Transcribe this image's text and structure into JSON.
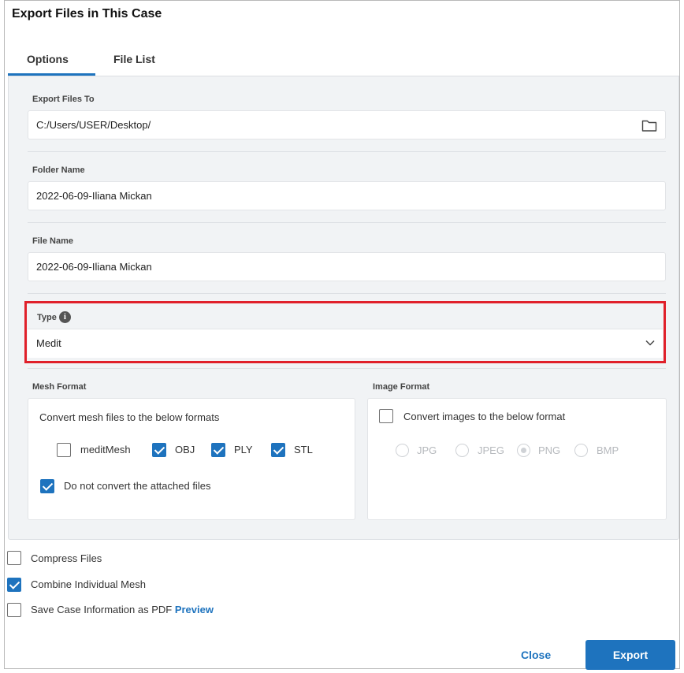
{
  "dialog": {
    "title": "Export Files in This Case"
  },
  "tabs": [
    {
      "label": "Options",
      "active": true
    },
    {
      "label": "File List",
      "active": false
    }
  ],
  "export_to": {
    "label": "Export Files To",
    "value": "C:/Users/USER/Desktop/",
    "icon": "folder-icon"
  },
  "folder_name": {
    "label": "Folder Name",
    "value": "2022-06-09-Iliana Mickan"
  },
  "file_name": {
    "label": "File Name",
    "value": "2022-06-09-Iliana Mickan"
  },
  "type": {
    "label": "Type",
    "info_glyph": "i",
    "value": "Medit",
    "highlight_color": "#e0202a"
  },
  "mesh_format": {
    "label": "Mesh Format",
    "description": "Convert mesh files to the below formats",
    "options": [
      {
        "label": "meditMesh",
        "checked": false
      },
      {
        "label": "OBJ",
        "checked": true
      },
      {
        "label": "PLY",
        "checked": true
      },
      {
        "label": "STL",
        "checked": true
      }
    ],
    "no_convert": {
      "label": "Do not convert the attached files",
      "checked": true
    }
  },
  "image_format": {
    "label": "Image Format",
    "convert": {
      "label": "Convert images to the below format",
      "checked": false
    },
    "options": [
      {
        "label": "JPG",
        "selected": false
      },
      {
        "label": "JPEG",
        "selected": false
      },
      {
        "label": "PNG",
        "selected": true
      },
      {
        "label": "BMP",
        "selected": false
      }
    ]
  },
  "options": {
    "compress": {
      "label": "Compress Files",
      "checked": false
    },
    "combine": {
      "label": "Combine Individual Mesh",
      "checked": true
    },
    "save_pdf": {
      "label": "Save Case Information as PDF",
      "checked": false,
      "link": "Preview"
    }
  },
  "footer": {
    "close_label": "Close",
    "export_label": "Export"
  },
  "colors": {
    "accent": "#1e73be",
    "highlight": "#e0202a"
  }
}
